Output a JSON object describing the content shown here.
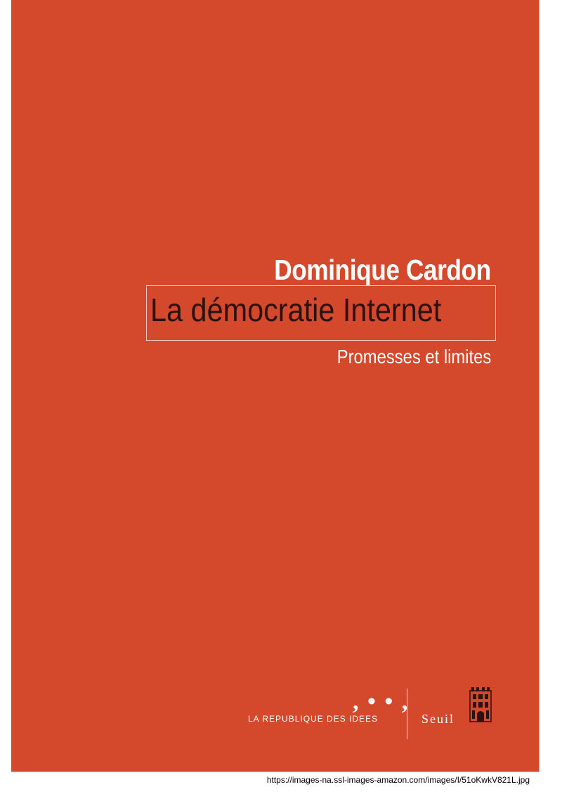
{
  "cover": {
    "background_color": "#d4492b",
    "author": "Dominique Cardon",
    "title": "La démocratie Internet",
    "subtitle": "Promesses et limites",
    "collection_mark": ", • • ,",
    "collection_name": "LA REPUBLIQUE DES IDEES",
    "publisher": "Seuil",
    "publisher_logo_icon": "seuil-seal-icon"
  },
  "source_url": "https://images-na.ssl-images-amazon.com/images/I/51oKwkV821L.jpg"
}
